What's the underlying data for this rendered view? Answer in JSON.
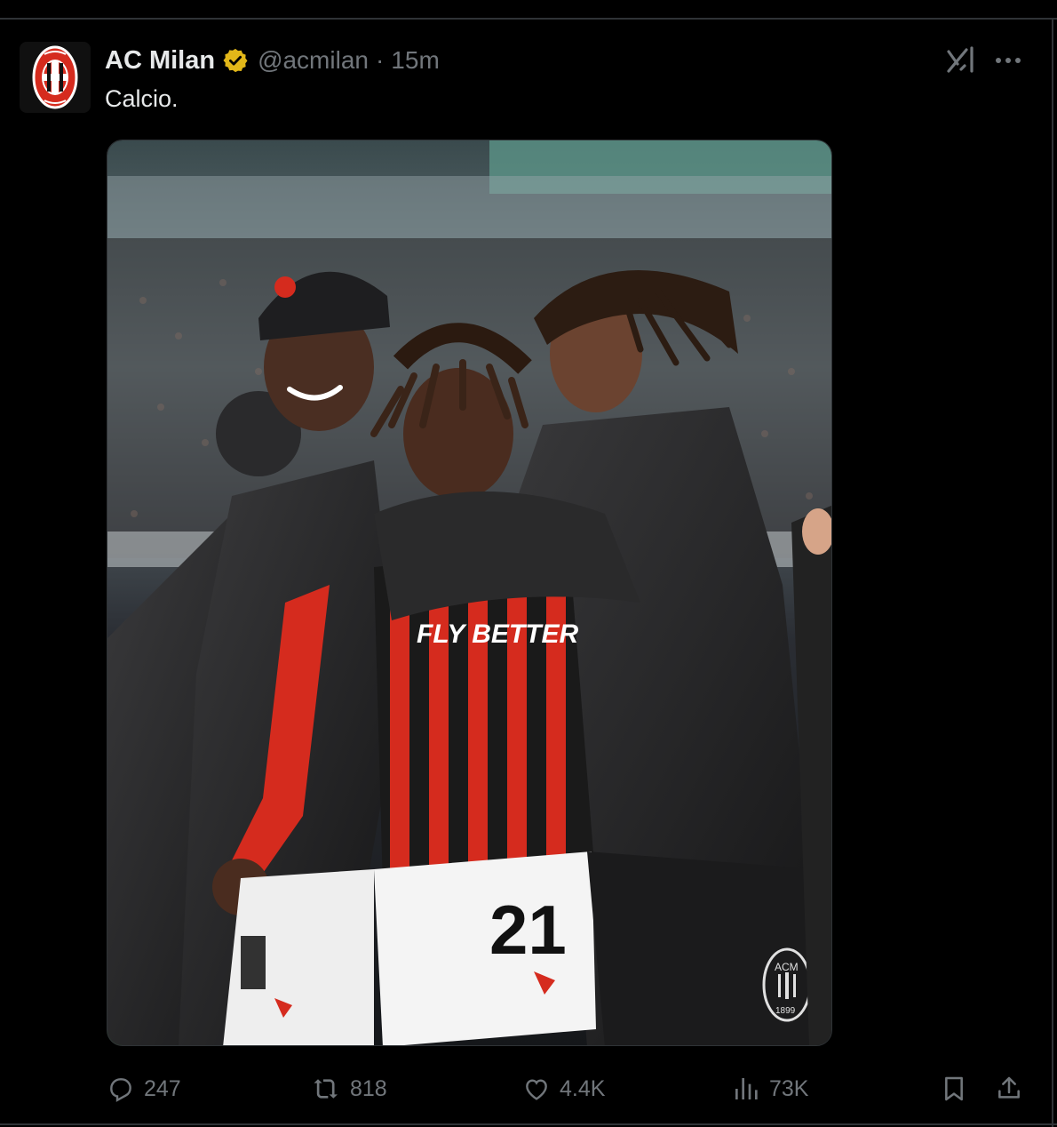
{
  "tweet": {
    "display_name": "AC Milan",
    "handle": "@acmilan",
    "separator": "·",
    "time": "15m",
    "text": "Calcio.",
    "verified_badge_color": "#e2b719"
  },
  "media": {
    "jersey_sponsor_text": "FLY BETTER",
    "shorts_number": "21",
    "crest_letters": "ACM",
    "crest_year": "1899"
  },
  "actions": {
    "replies": "247",
    "retweets": "818",
    "likes": "4.4K",
    "views": "73K"
  },
  "colors": {
    "background": "#000000",
    "text_primary": "#e7e9ea",
    "text_secondary": "#71767b",
    "milan_red": "#d52b1e"
  },
  "icons": [
    "verified-badge-icon",
    "grok-icon",
    "more-icon",
    "reply-icon",
    "retweet-icon",
    "like-icon",
    "views-icon",
    "bookmark-icon",
    "share-icon"
  ]
}
